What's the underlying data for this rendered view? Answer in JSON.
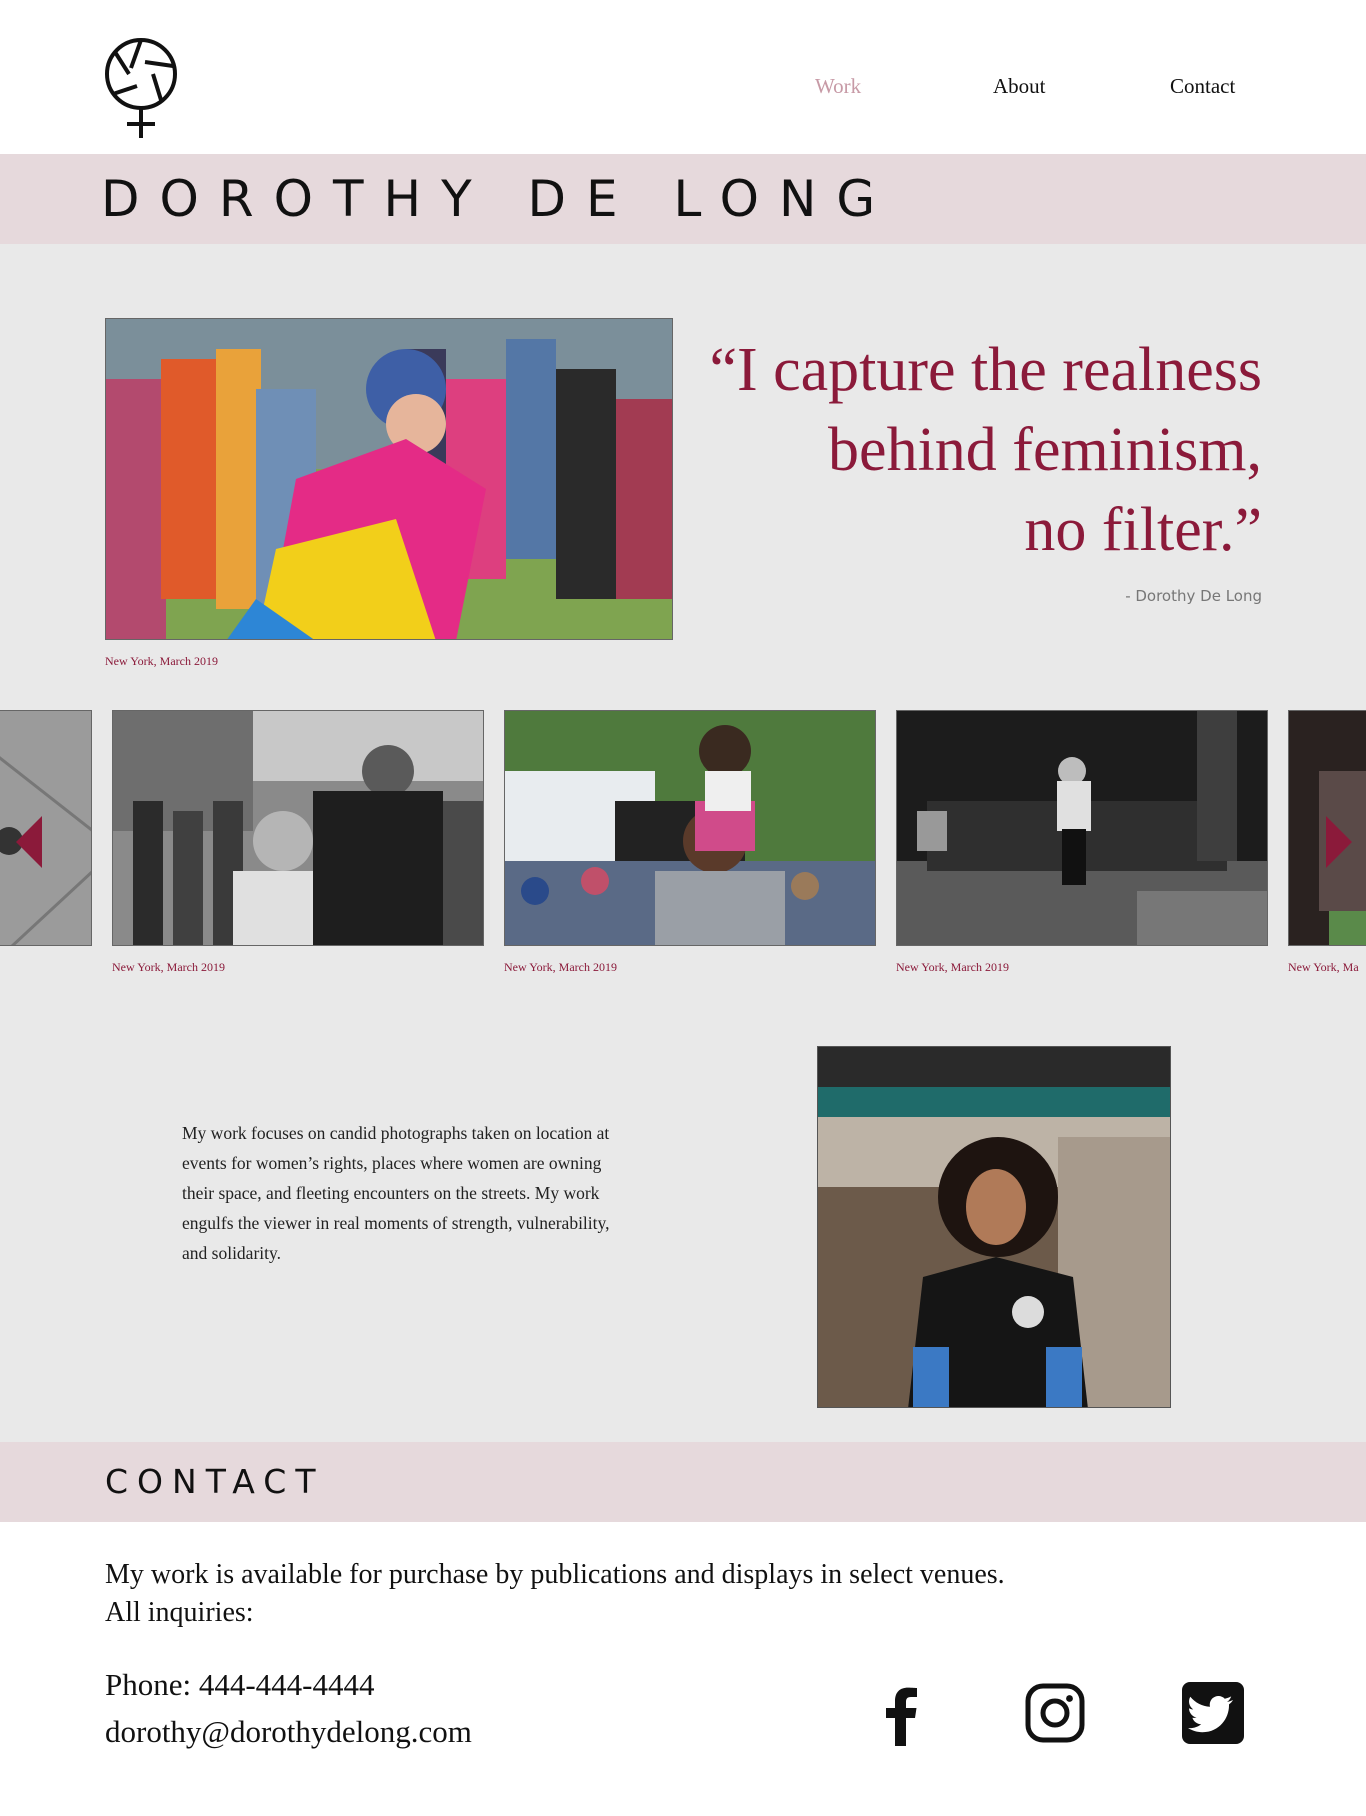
{
  "nav": {
    "work": "Work",
    "about": "About",
    "contact": "Contact"
  },
  "site": {
    "name": "DOROTHY DE LONG"
  },
  "hero": {
    "caption": "New York, March 2019",
    "quote_line1": "“I capture the realness",
    "quote_line2": "behind feminism,",
    "quote_line3": "no filter.”",
    "quote_author": "- Dorothy De Long"
  },
  "carousel": {
    "captions": [
      "New York, March 2019",
      "New York, March 2019",
      "New York, March 2019",
      "New York, Ma"
    ]
  },
  "bio": {
    "text": "My work focuses on candid photographs taken on location at events for women’s rights, places where women are owning their space, and fleeting encounters on the streets. My work engulfs the viewer in real moments of strength, vulnerability, and solidarity."
  },
  "contact": {
    "title": "CONTACT",
    "line1": "My work is available for purchase by publications and  displays in select venues.",
    "line2": "All inquiries:",
    "phone": "Phone: 444-444-4444",
    "email": "dorothy@dorothydelong.com"
  },
  "icons": {
    "logo": "camera-aperture-venus-logo",
    "social": [
      "facebook-icon",
      "instagram-icon",
      "twitter-icon"
    ]
  },
  "colors": {
    "accent": "#8b1a3a",
    "nav_active": "#c79aa6",
    "band": "#e6d9dc",
    "background": "#e9e9e9"
  }
}
